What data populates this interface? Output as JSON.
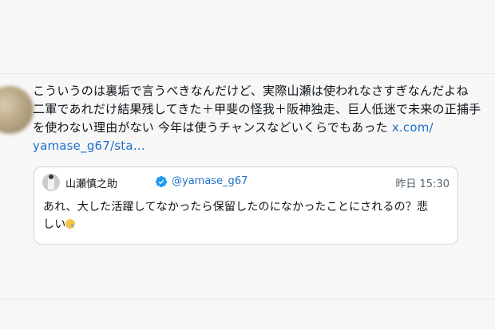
{
  "post": {
    "lines": [
      "こういうのは裏垢で言うべきなんだけど、実際山瀬は使われなさすぎなんだよね",
      "二軍であれだけ結果残してきた＋甲斐の怪我＋阪神独走、巨人低迷で未来の正捕手",
      "を使わない理由がない 今年は使うチャンスなどいくらでもあった "
    ],
    "link_part1": "x.com/",
    "link_part2": "yamase_g67/sta…"
  },
  "quote": {
    "author_name": "山瀬慎之助",
    "handle": "@yamase_g67",
    "time": "昨日 15:30",
    "lines": [
      "あれ、大した活躍してなかったら保留したのになかったことにされるの？悲",
      "しい"
    ],
    "emoji": "crying-face-emoji"
  },
  "colors": {
    "background": "#f7f7f7",
    "link": "#1d6fc9",
    "text": "#0f1419",
    "verified": "#1d9bf0"
  }
}
